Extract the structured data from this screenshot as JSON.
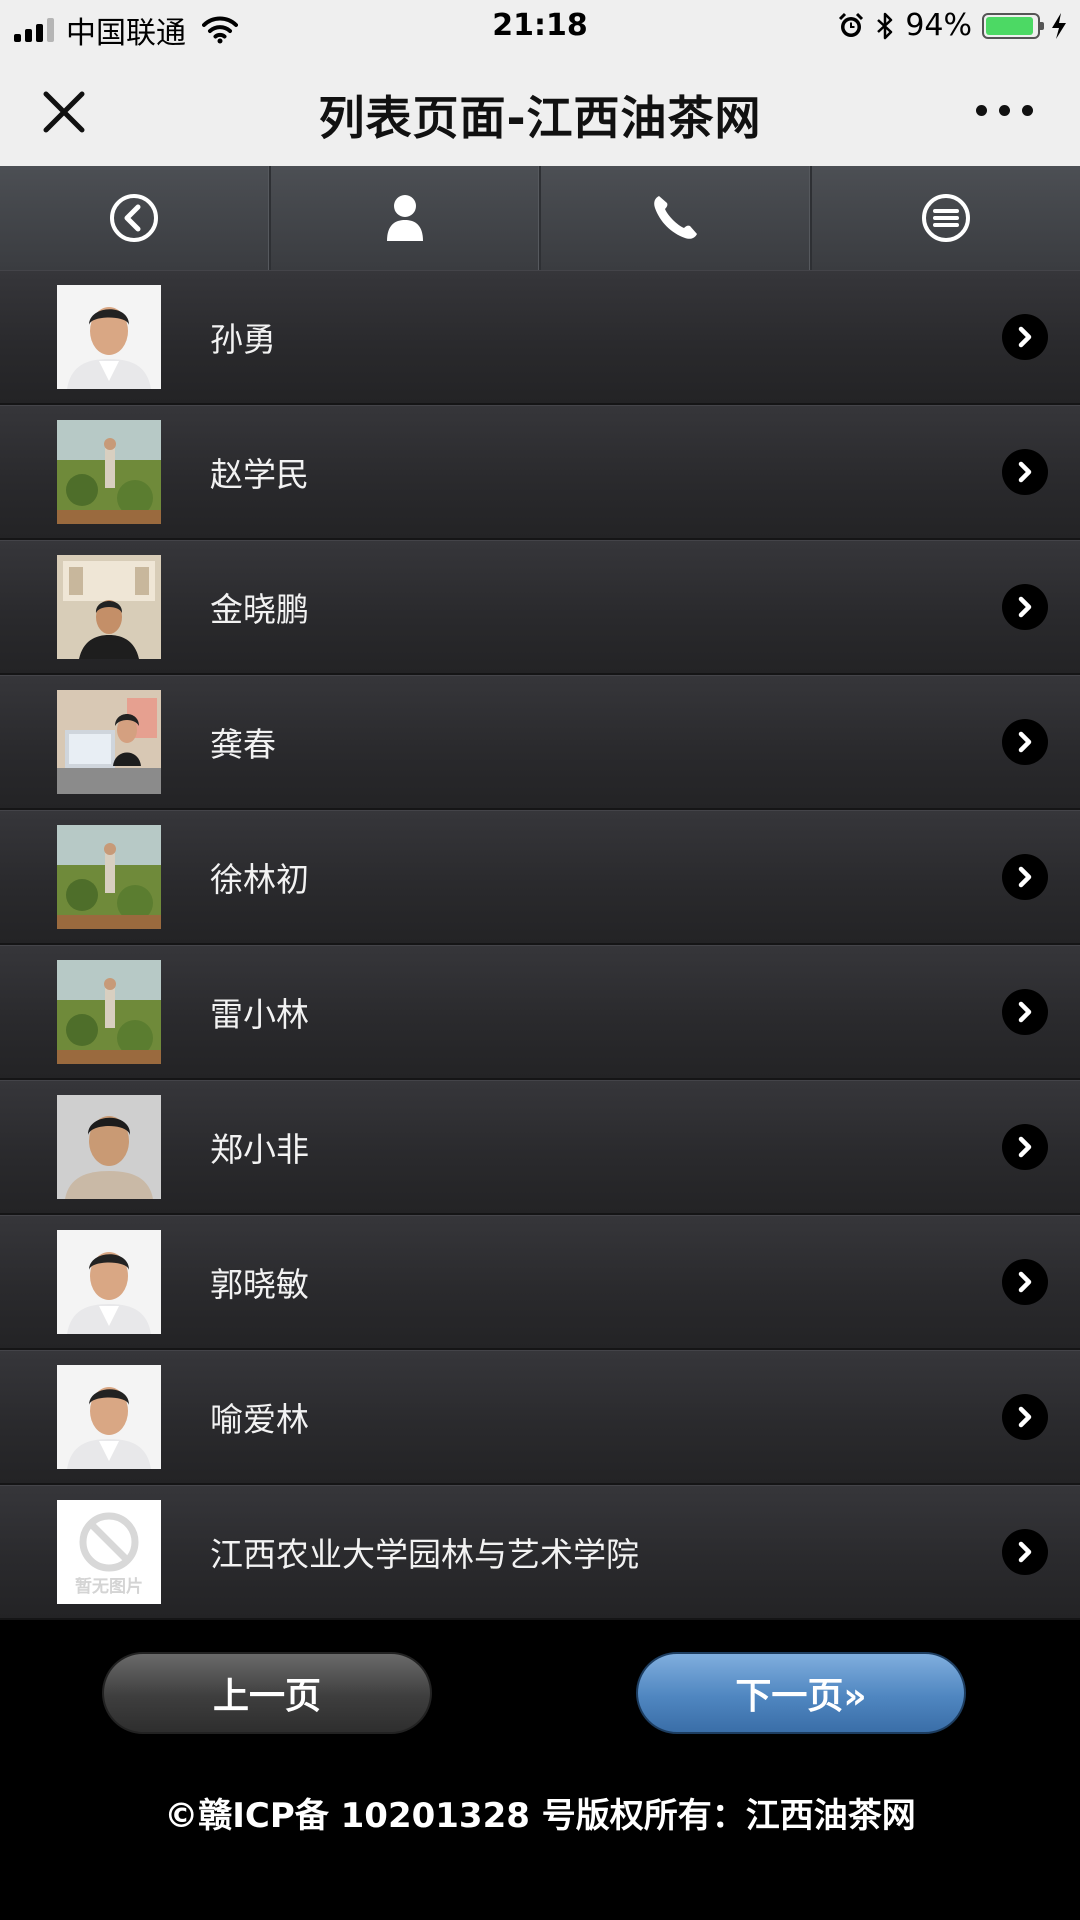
{
  "status_bar": {
    "carrier": "中国联通",
    "time": "21:18",
    "battery": "94%",
    "battery_level": 0.94
  },
  "header": {
    "title": "列表页面-江西油茶网"
  },
  "toolbar": {
    "items": [
      {
        "icon": "back-circle-icon"
      },
      {
        "icon": "user-icon"
      },
      {
        "icon": "phone-icon"
      },
      {
        "icon": "menu-icon"
      }
    ]
  },
  "list": {
    "items": [
      {
        "name": "孙勇",
        "photo": "portrait-white-bg"
      },
      {
        "name": "赵学民",
        "photo": "field-photo"
      },
      {
        "name": "金晓鹏",
        "photo": "indoor-photo"
      },
      {
        "name": "龚春",
        "photo": "desk-photo"
      },
      {
        "name": "徐林初",
        "photo": "field-photo"
      },
      {
        "name": "雷小林",
        "photo": "field-photo"
      },
      {
        "name": "郑小非",
        "photo": "portrait-gray-bg"
      },
      {
        "name": "郭晓敏",
        "photo": "portrait-white-bg"
      },
      {
        "name": "喻爱林",
        "photo": "portrait-white-bg"
      },
      {
        "name": "江西农业大学园林与艺术学院",
        "photo": "no-image",
        "placeholder_text": "暂无图片"
      }
    ]
  },
  "pager": {
    "prev_label": "上一页",
    "next_label": "下一页»"
  },
  "footer": {
    "text": "©赣ICP备 10201328 号版权所有：江西油茶网"
  },
  "colors": {
    "row_bg": "#2a2a2d",
    "next_button": "#4f86c0",
    "battery": "#4cd964"
  }
}
